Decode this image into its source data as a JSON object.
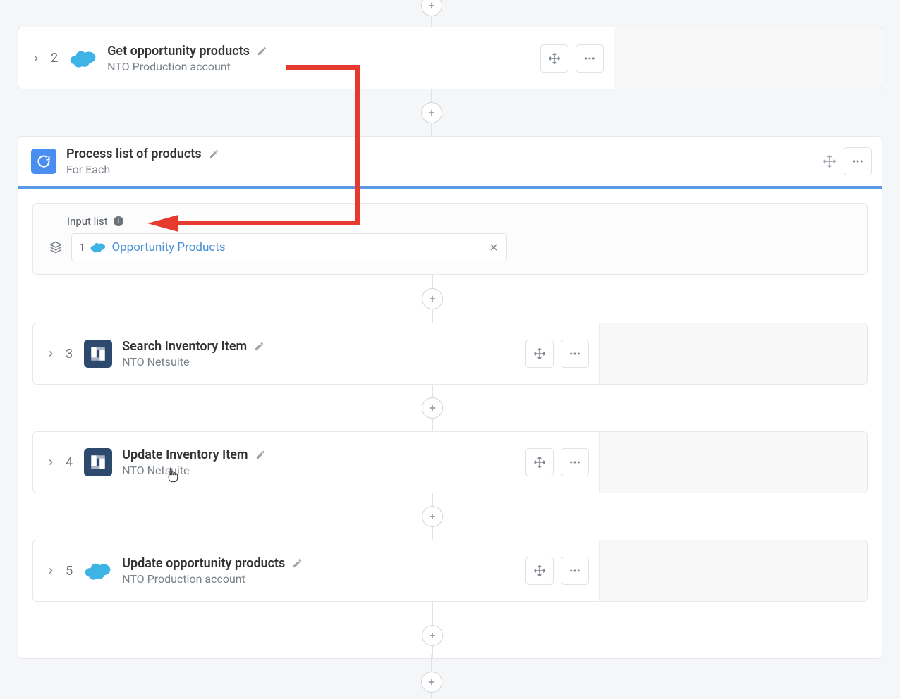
{
  "steps": {
    "s2": {
      "num": "2",
      "title": "Get opportunity products",
      "subtitle": "NTO Production account"
    },
    "s3": {
      "num": "3",
      "title": "Search Inventory Item",
      "subtitle": "NTO Netsuite"
    },
    "s4": {
      "num": "4",
      "title": "Update Inventory Item",
      "subtitle": "NTO Netsuite"
    },
    "s5": {
      "num": "5",
      "title": "Update opportunity products",
      "subtitle": "NTO Production account"
    }
  },
  "foreach": {
    "title": "Process list of products",
    "subtitle": "For Each",
    "input_label": "Input list",
    "pill_num": "1",
    "pill_text": "Opportunity Products"
  }
}
